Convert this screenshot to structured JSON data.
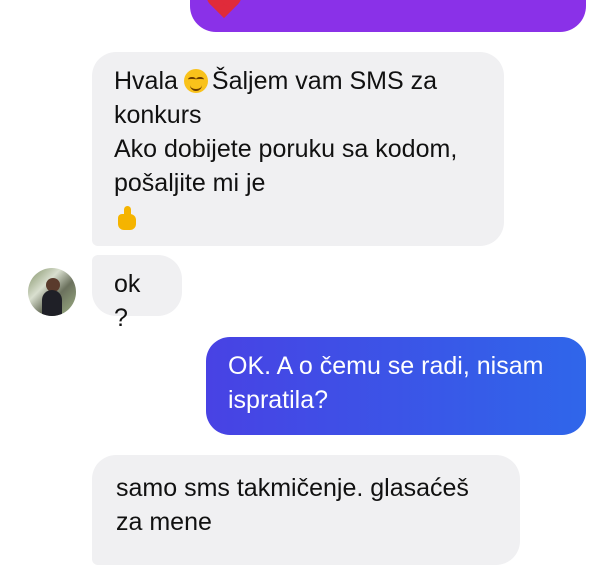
{
  "conversation": {
    "messages": [
      {
        "sender": "other",
        "line1_prefix": "Hvala",
        "line1_suffix": "Šaljem vam SMS za",
        "line2": "konkurs",
        "line3": "Ako dobijete poruku sa kodom,",
        "line4": "pošaljite mi je"
      },
      {
        "sender": "other",
        "text": "ok ?"
      },
      {
        "sender": "me",
        "line1": "OK. A o čemu se radi, nisam",
        "line2": "ispratila?"
      },
      {
        "sender": "other",
        "line1": "samo sms takmičenje. glasaćeš",
        "line2": "za mene"
      }
    ]
  },
  "icons": {
    "top_bubble": "heart-icon",
    "message_emoji_1": "hugging-face-emoji",
    "message_emoji_2": "thumbs-up-emoji",
    "avatar": "contact-avatar"
  },
  "colors": {
    "top_bubble": "#8a31e8",
    "incoming_bubble": "#f0f0f2",
    "outgoing_start": "#4842e4",
    "outgoing_end": "#2f66ea",
    "heart": "#e02b3a",
    "emoji_yellow": "#f5b400"
  }
}
